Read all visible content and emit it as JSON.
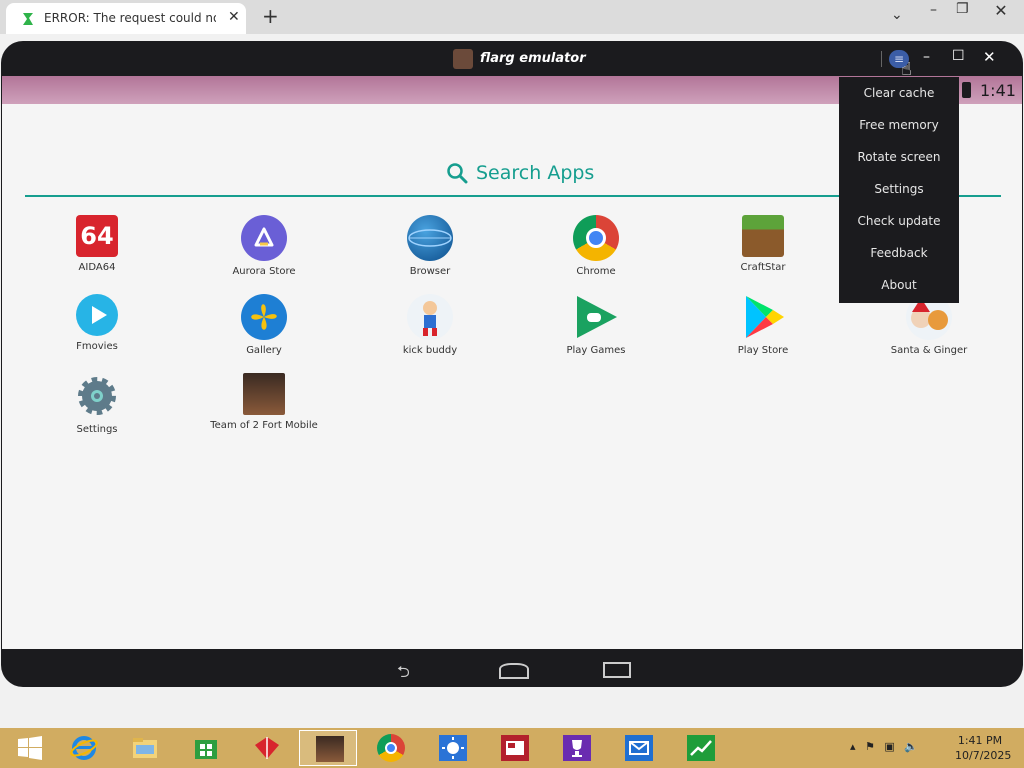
{
  "browser": {
    "tab_title": "ERROR: The request could not be",
    "tab_close": "✕",
    "new_tab": "+",
    "tab_search": "⌄",
    "minimize": "–",
    "restore": "❐",
    "close": "✕"
  },
  "emulator": {
    "title": "flarg emulator",
    "menu_icon": "≡",
    "minimize": "–",
    "maximize": "☐",
    "close": "✕",
    "status_time": "1:41"
  },
  "launcher": {
    "search_label": "Search Apps",
    "apps": [
      {
        "name": "AIDA64"
      },
      {
        "name": "Aurora Store"
      },
      {
        "name": "Browser"
      },
      {
        "name": "Chrome"
      },
      {
        "name": "CraftStar"
      },
      {
        "name": "Fmovies"
      },
      {
        "name": "Gallery"
      },
      {
        "name": "kick buddy"
      },
      {
        "name": "Play Games"
      },
      {
        "name": "Play Store"
      },
      {
        "name": "Santa & Ginger"
      },
      {
        "name": "Settings"
      },
      {
        "name": "Team of 2 Fort Mobile"
      }
    ],
    "aida_icon_text": "64"
  },
  "menu": {
    "items": [
      "Clear cache",
      "Free memory",
      "Rotate screen",
      "Settings",
      "Check update",
      "Feedback",
      "About"
    ]
  },
  "taskbar": {
    "time": "1:41 PM",
    "date": "10/7/2025"
  },
  "colors": {
    "accent": "#169e8f",
    "statusbar": "#c18eac",
    "taskbar": "#d1ac61"
  }
}
